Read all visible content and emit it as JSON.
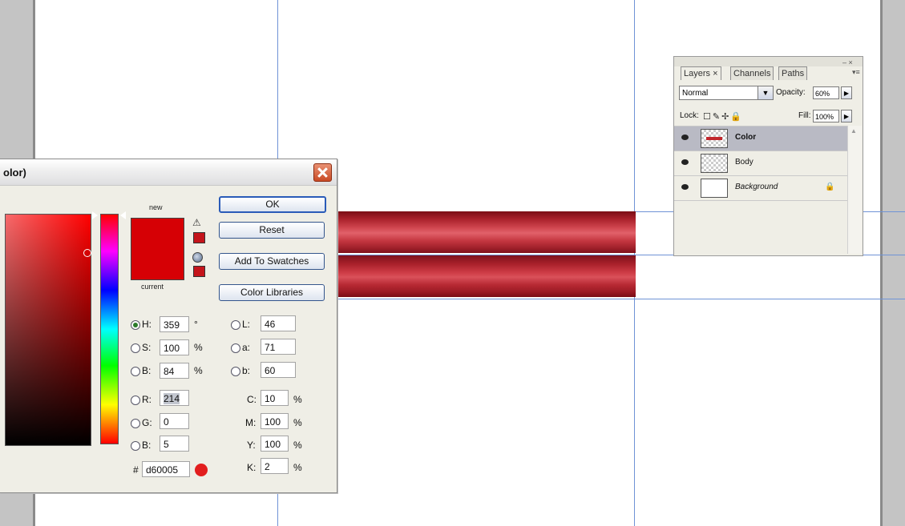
{
  "dialog": {
    "title_fragment": "olor)",
    "label_new": "new",
    "label_current": "current",
    "buttons": {
      "ok": "OK",
      "reset": "Reset",
      "add_swatches": "Add To Swatches",
      "color_libraries": "Color Libraries"
    },
    "hsb": {
      "h": {
        "label": "H:",
        "value": "359",
        "unit": "°"
      },
      "s": {
        "label": "S:",
        "value": "100",
        "unit": "%"
      },
      "b": {
        "label": "B:",
        "value": "84",
        "unit": "%"
      }
    },
    "rgb": {
      "r": {
        "label": "R:",
        "value": "214"
      },
      "g": {
        "label": "G:",
        "value": "0"
      },
      "b": {
        "label": "B:",
        "value": "5"
      }
    },
    "lab": {
      "l": {
        "label": "L:",
        "value": "46"
      },
      "a": {
        "label": "a:",
        "value": "71"
      },
      "b": {
        "label": "b:",
        "value": "60"
      }
    },
    "cmyk": {
      "c": {
        "label": "C:",
        "value": "10",
        "unit": "%"
      },
      "m": {
        "label": "M:",
        "value": "100",
        "unit": "%"
      },
      "y": {
        "label": "Y:",
        "value": "100",
        "unit": "%"
      },
      "k": {
        "label": "K:",
        "value": "2",
        "unit": "%"
      }
    },
    "hex": {
      "label": "#",
      "value": "d60005"
    },
    "selected_mode": "H",
    "current_color": "#d60005"
  },
  "layers_panel": {
    "window_controls": "– ×",
    "tabs": [
      "Layers ×",
      "Channels",
      "Paths"
    ],
    "blend_mode": "Normal",
    "opacity_label": "Opacity:",
    "opacity_value": "60%",
    "lock_label": "Lock:",
    "fill_label": "Fill:",
    "fill_value": "100%",
    "layers": [
      {
        "name": "Color",
        "selected": true
      },
      {
        "name": "Body",
        "selected": false
      },
      {
        "name": "Background",
        "selected": false,
        "locked": true
      }
    ]
  },
  "icons": [
    "close-icon",
    "gamut-warning-icon",
    "web-safe-icon",
    "eye-icon",
    "lock-icon",
    "dropdown-arrow-icon",
    "panel-menu-icon"
  ]
}
